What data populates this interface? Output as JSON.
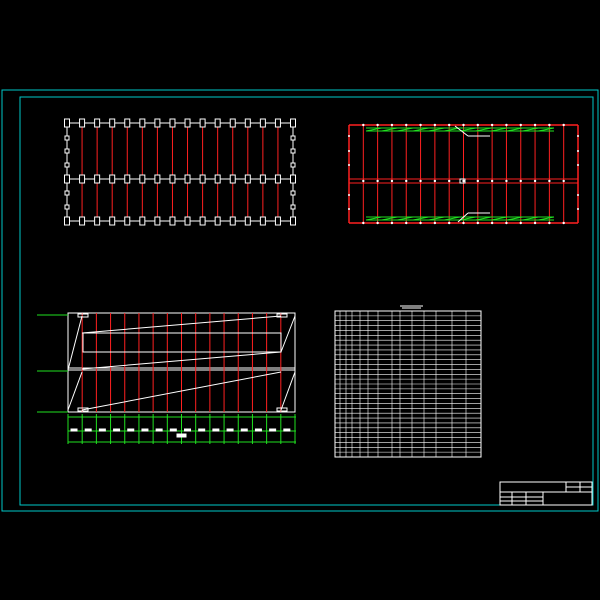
{
  "colors": {
    "background": "#000000",
    "frame": "#00c8c8",
    "member": "#ff2020",
    "outline": "#ffffff",
    "accent": "#20e020"
  },
  "drawing": {
    "plan_a": {
      "bays": 15,
      "has_mid_axis": true
    },
    "plan_b": {
      "bays": 16,
      "bracing_bays": 12
    },
    "elevation": {
      "bays": 16,
      "level_lines": 3
    },
    "schedule": {
      "rows": 30,
      "cols": 13
    },
    "title_block": {
      "rows": 3
    }
  }
}
